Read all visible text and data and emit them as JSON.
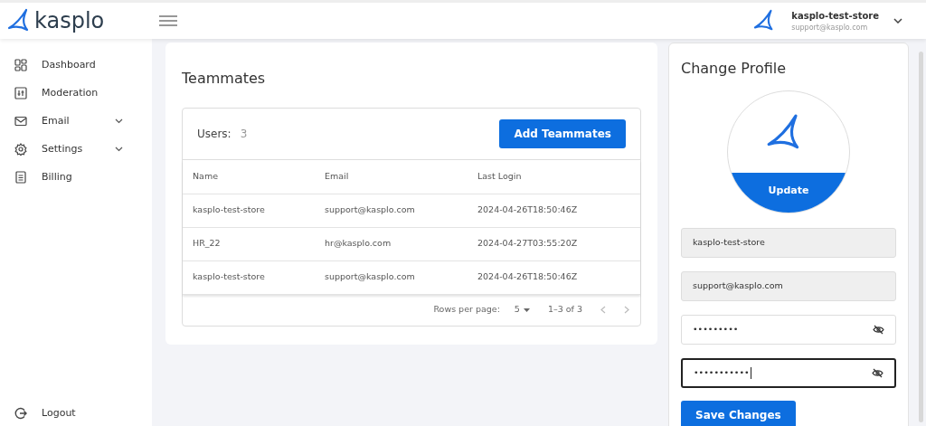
{
  "brand": {
    "name": "kasplo"
  },
  "account": {
    "name": "kasplo-test-store",
    "email": "support@kasplo.com"
  },
  "sidebar": {
    "items": [
      {
        "label": "Dashboard",
        "expandable": false
      },
      {
        "label": "Moderation",
        "expandable": false
      },
      {
        "label": "Email",
        "expandable": true
      },
      {
        "label": "Settings",
        "expandable": true
      },
      {
        "label": "Billing",
        "expandable": false
      }
    ],
    "logout": "Logout"
  },
  "teammates": {
    "title": "Teammates",
    "users_label": "Users:",
    "users_count": "3",
    "add_button": "Add Teammates",
    "table": {
      "columns": [
        "Name",
        "Email",
        "Last Login"
      ],
      "rows": [
        [
          "kasplo-test-store",
          "support@kasplo.com",
          "2024-04-26T18:50:46Z"
        ],
        [
          "HR_22",
          "hr@kasplo.com",
          "2024-04-27T03:55:20Z"
        ],
        [
          "kasplo-test-store",
          "support@kasplo.com",
          "2024-04-26T18:50:46Z"
        ]
      ]
    },
    "pagination": {
      "rows_label": "Rows per page:",
      "rows_value": "5",
      "range": "1–3 of 3"
    }
  },
  "profile": {
    "title": "Change Profile",
    "update_button": "Update",
    "fields": [
      {
        "kind": "text",
        "value": "kasplo-test-store",
        "disabled": true,
        "focused": false
      },
      {
        "kind": "text",
        "value": "support@kasplo.com",
        "disabled": true,
        "focused": false
      },
      {
        "kind": "password",
        "value": "•••••••••",
        "disabled": false,
        "focused": false
      },
      {
        "kind": "password",
        "value": "•••••••••••",
        "disabled": false,
        "focused": true
      }
    ],
    "save_button": "Save Changes"
  }
}
